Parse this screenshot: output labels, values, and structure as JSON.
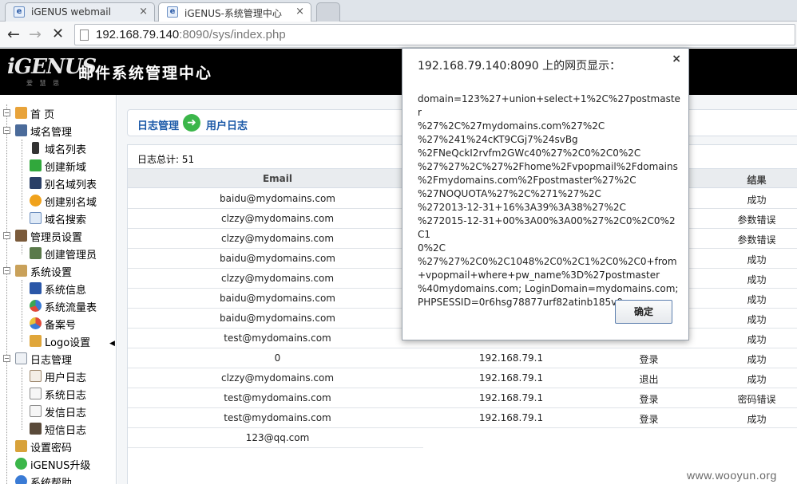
{
  "browser": {
    "tabs": [
      {
        "label": "iGENUS webmail",
        "active": false
      },
      {
        "label": "iGENUS-系统管理中心",
        "active": true
      }
    ],
    "tab_close": "×",
    "url_host": "192.168.79.140",
    "url_rest": ":8090/sys/index.php"
  },
  "app": {
    "logo_text": "iGENUS",
    "logo_sub": "爱 慧 思",
    "title": "邮件系统管理中心"
  },
  "sidebar": {
    "items": [
      {
        "label": "首 页",
        "icon": "home-icon"
      },
      {
        "label": "域名管理",
        "icon": "domain-manage-icon"
      },
      {
        "label": "域名列表",
        "icon": "domain-list-icon"
      },
      {
        "label": "创建新域",
        "icon": "create-domain-icon"
      },
      {
        "label": "别名域列表",
        "icon": "alias-list-icon"
      },
      {
        "label": "创建别名域",
        "icon": "create-alias-icon"
      },
      {
        "label": "域名搜索",
        "icon": "domain-search-icon"
      },
      {
        "label": "管理员设置",
        "icon": "admin-icon"
      },
      {
        "label": "创建管理员",
        "icon": "create-admin-icon"
      },
      {
        "label": "系统设置",
        "icon": "settings-icon"
      },
      {
        "label": "系统信息",
        "icon": "monitor-icon"
      },
      {
        "label": "系统流量表",
        "icon": "traffic-icon"
      },
      {
        "label": "备案号",
        "icon": "record-icon"
      },
      {
        "label": "Logo设置",
        "icon": "logo-settings-icon"
      },
      {
        "label": "日志管理",
        "icon": "log-manage-icon"
      },
      {
        "label": "用户日志",
        "icon": "user-log-icon"
      },
      {
        "label": "系统日志",
        "icon": "system-log-icon"
      },
      {
        "label": "发信日志",
        "icon": "send-log-icon"
      },
      {
        "label": "短信日志",
        "icon": "sms-log-icon"
      },
      {
        "label": "设置密码",
        "icon": "key-icon"
      },
      {
        "label": "iGENUS升级",
        "icon": "upgrade-icon"
      },
      {
        "label": "系统帮助",
        "icon": "help-icon"
      }
    ]
  },
  "main": {
    "breadcrumb": {
      "first": "日志管理",
      "second": "用户日志"
    },
    "total": "日志总计: 51",
    "columns": {
      "email": "Email",
      "result": "结果"
    },
    "rows": [
      {
        "email": "baidu@mydomains.com",
        "ip": "",
        "action": "",
        "result": "成功"
      },
      {
        "email": "clzzy@mydomains.com",
        "ip": "",
        "action": "",
        "result": "参数错误"
      },
      {
        "email": "clzzy@mydomains.com",
        "ip": "",
        "action": "",
        "result": "参数错误"
      },
      {
        "email": "baidu@mydomains.com",
        "ip": "",
        "action": "",
        "result": "成功"
      },
      {
        "email": "clzzy@mydomains.com",
        "ip": "",
        "action": "",
        "result": "成功"
      },
      {
        "email": "baidu@mydomains.com",
        "ip": "",
        "action": "",
        "result": "成功"
      },
      {
        "email": "baidu@mydomains.com",
        "ip": "",
        "action": "",
        "result": "成功"
      },
      {
        "email": "test@mydomains.com",
        "ip": "",
        "action": "",
        "result": "成功"
      },
      {
        "email": "0",
        "ip": "192.168.79.1",
        "action": "登录",
        "result": "成功"
      },
      {
        "email": "clzzy@mydomains.com",
        "ip": "192.168.79.1",
        "action": "退出",
        "result": "成功"
      },
      {
        "email": "test@mydomains.com",
        "ip": "192.168.79.1",
        "action": "登录",
        "result": "密码错误"
      },
      {
        "email": "test@mydomains.com",
        "ip": "192.168.79.1",
        "action": "登录",
        "result": "成功"
      },
      {
        "email": "123@qq.com",
        "ip": "",
        "action": "",
        "result": ""
      }
    ]
  },
  "dialog": {
    "title": "192.168.79.140:8090 上的网页显示：",
    "close": "×",
    "message": "domain=123%27+union+select+1%2C%27postmaster\n%27%2C%27mydomains.com%27%2C\n%27%241%24cKT9CGj7%24svBg\n%2FNeQckI2rvfm2GWc40%27%2C0%2C0%2C\n%27%27%2C%27%2Fhome%2Fvpopmail%2Fdomains\n%2Fmydomains.com%2Fpostmaster%27%2C\n%27NOQUOTA%27%2C%271%27%2C\n%272013-12-31+16%3A39%3A38%27%2C\n%272015-12-31+00%3A00%3A00%27%2C0%2C0%2C1\n0%2C\n%27%27%2C0%2C1048%2C0%2C1%2C0%2C0+from\n+vpopmail+where+pw_name%3D%27postmaster\n%40mydomains.com; LoginDomain=mydomains.com;\nPHPSESSID=0r6hsg78877urf82atinb185v0",
    "ok_label": "确定"
  },
  "watermark": "www.wooyun.org"
}
